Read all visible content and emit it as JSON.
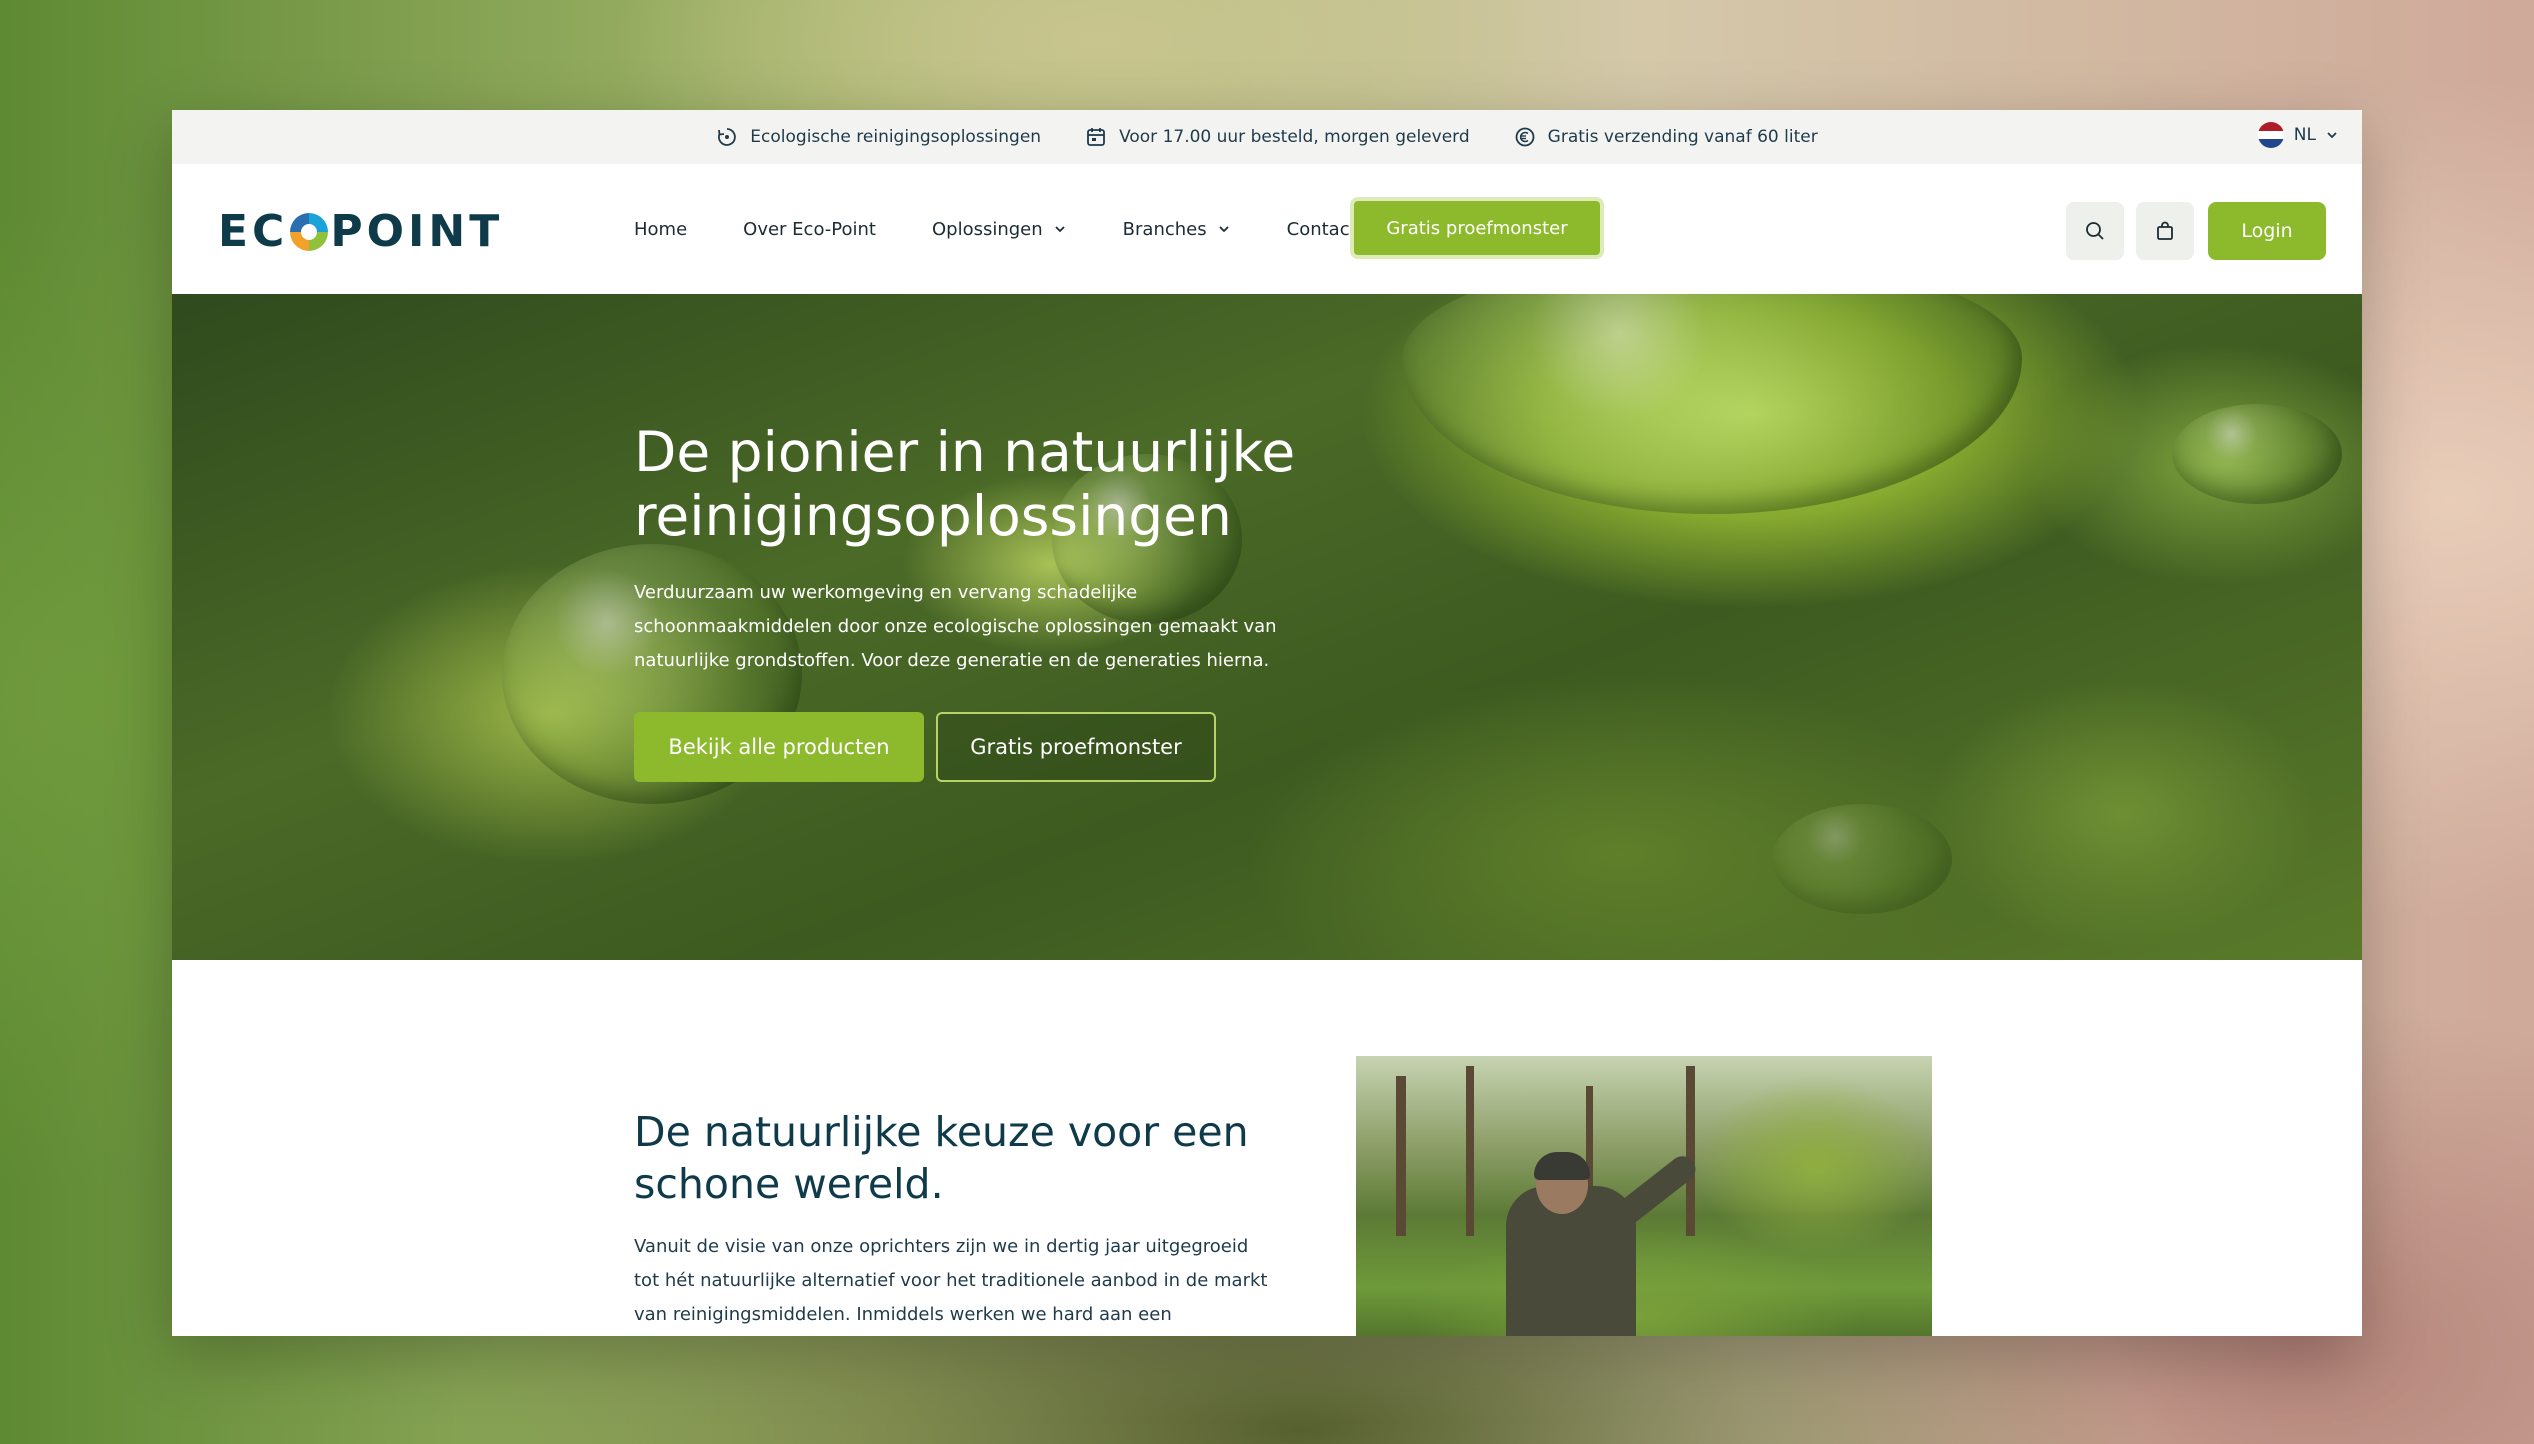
{
  "topbar": {
    "usps": [
      {
        "icon": "recycle-icon",
        "text": "Ecologische reinigingsoplossingen"
      },
      {
        "icon": "delivery-calendar-icon",
        "text": "Voor 17.00 uur besteld, morgen geleverd"
      },
      {
        "icon": "euro-circle-icon",
        "text": "Gratis verzending vanaf 60 liter"
      }
    ],
    "language": {
      "code": "NL",
      "icon": "netherlands-flag-icon"
    }
  },
  "header": {
    "logo": {
      "left": "EC",
      "right": "POINT"
    },
    "nav": [
      {
        "label": "Home",
        "dropdown": false
      },
      {
        "label": "Over Eco-Point",
        "dropdown": false
      },
      {
        "label": "Oplossingen",
        "dropdown": true
      },
      {
        "label": "Branches",
        "dropdown": true
      },
      {
        "label": "Contact",
        "dropdown": false
      }
    ],
    "cta_label": "Gratis proefmonster",
    "search_icon": "search-icon",
    "cart_icon": "shopping-bag-icon",
    "login_label": "Login"
  },
  "hero": {
    "title": "De pionier in natuurlijke reinigingsoplossingen",
    "text": "Verduurzaam uw werkomgeving en vervang schadelijke schoonmaakmiddelen door onze ecologische oplossingen gemaakt van natuurlijke grondstoffen. Voor deze generatie en de generaties hierna.",
    "primary_button": "Bekijk alle producten",
    "secondary_button": "Gratis proefmonster"
  },
  "about": {
    "title": "De natuurlijke keuze voor een schone wereld.",
    "text": "Vanuit de visie van onze oprichters zijn we in dertig jaar uitgegroeid tot hét natuurlijke alternatief voor het traditionele aanbod in de markt van reinigingsmiddelen. Inmiddels werken we hard aan een"
  },
  "colors": {
    "brand_green": "#8dba2c",
    "brand_navy": "#0f3a4a",
    "topbar_bg": "#f3f4f1"
  }
}
